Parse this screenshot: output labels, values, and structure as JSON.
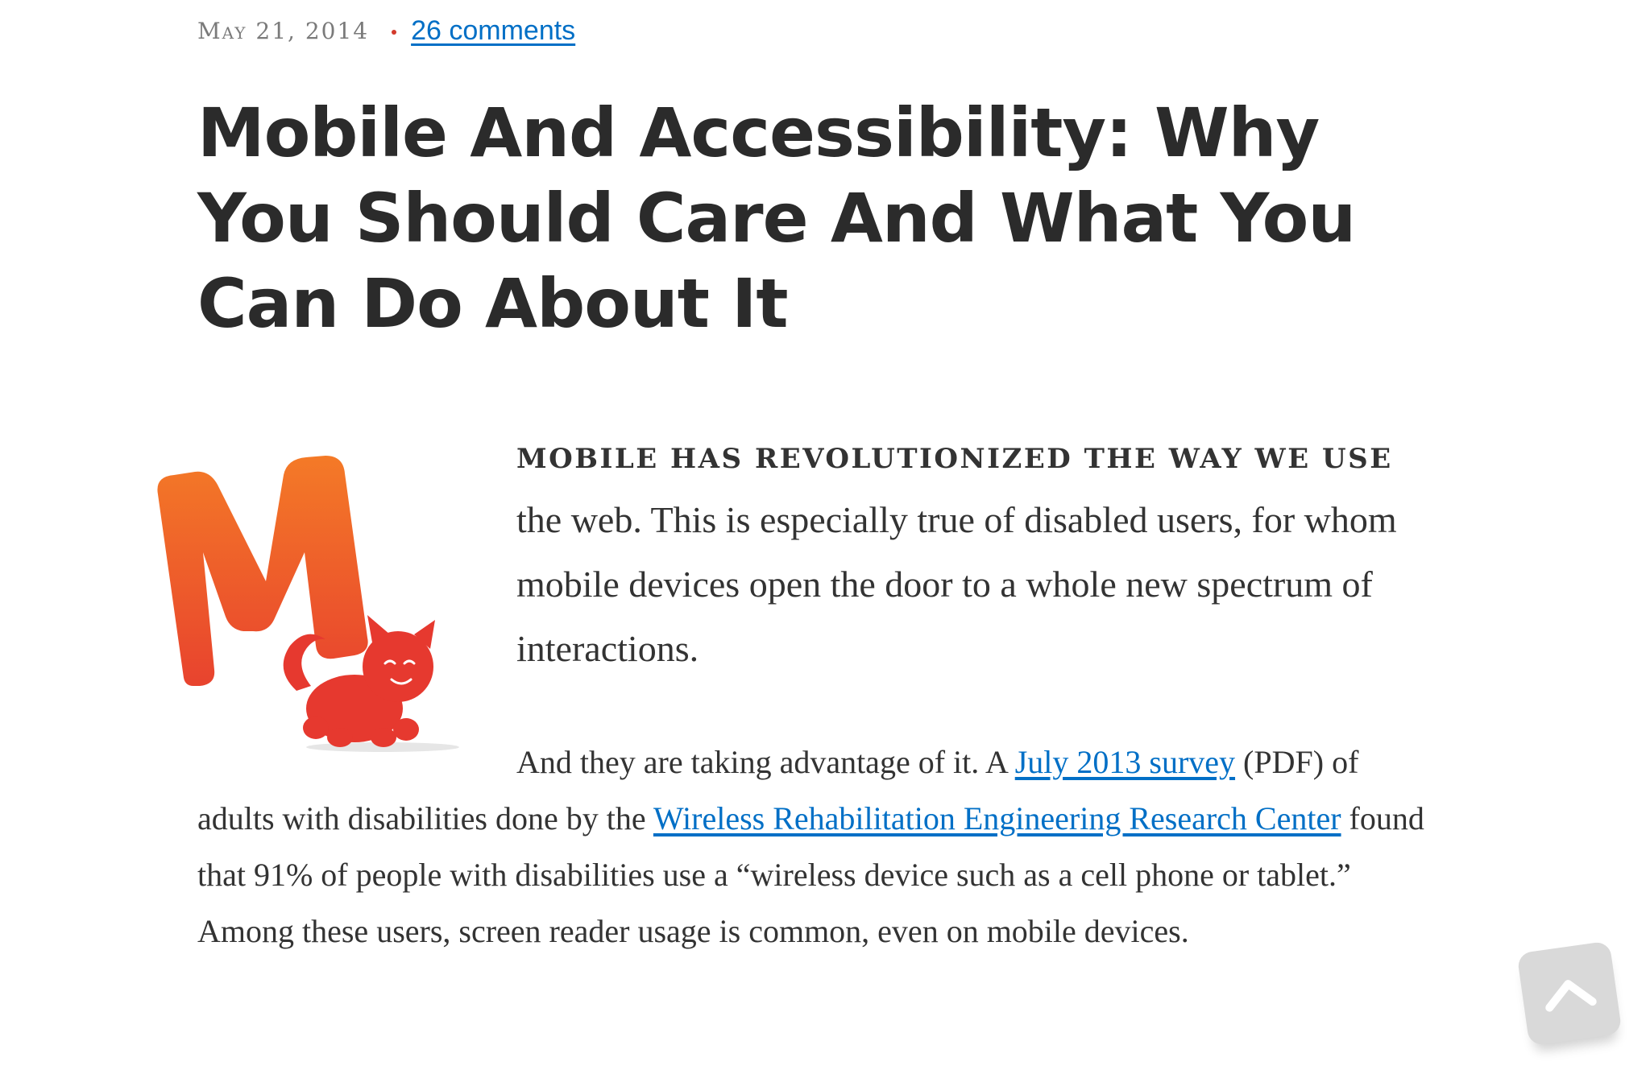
{
  "meta": {
    "date": "May 21, 2014",
    "separator": "•",
    "comments_link": "26 comments"
  },
  "article": {
    "title": "Mobile And Accessibility: Why You Should Care And What You Can Do About It",
    "lead_caps": "Mobile has revolutionized the way we use",
    "lead_rest": "the web. This is especially true of disabled users, for whom mobile devices open the door to a whole new spectrum of interactions.",
    "para": {
      "text_1": "And they are taking advantage of it. A ",
      "link_1": "July 2013 survey",
      "text_2": " (PDF) of adults with disabilities done by the ",
      "link_2": "Wireless Rehabilitation Engineering Research Center",
      "text_3": " found that 91% of people with disabilities use a “wireless device such as a cell phone or tablet.” Among these users, screen reader usage is common, even on mobile devices."
    }
  },
  "icons": {
    "logo": "smashing-magazine-m-cat-logo",
    "scroll_top": "chevron-up-icon"
  },
  "colors": {
    "link": "#006fc6",
    "text": "#333333",
    "title": "#2b2b2b",
    "meta": "#7a7a7a",
    "accent_dot": "#d33a2c",
    "logo_orange": "#f26b2a",
    "logo_red": "#e6392f",
    "scroll_button": "#d9d9d9"
  }
}
